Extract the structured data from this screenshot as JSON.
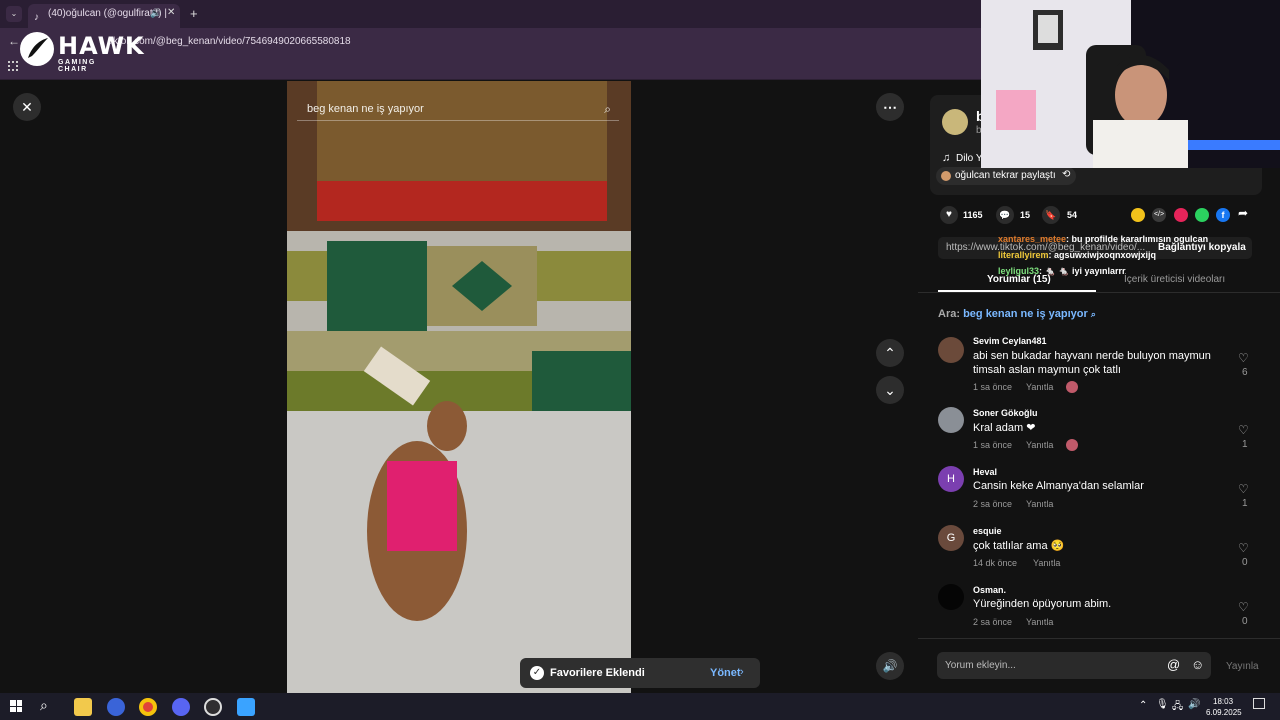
{
  "browser": {
    "tab_title": "(40)oğulcan (@ogulfirattt) |",
    "url": "tiktok.com/@beg_kenan/video/7546949020665580818"
  },
  "overlay": {
    "brand": "HAWK",
    "brand_sub": "GAMING CHAIR"
  },
  "video": {
    "search_text": "beg kenan ne iş yapıyor"
  },
  "toast": {
    "message": "Favorilere Eklendi",
    "action": "Yönet"
  },
  "panel": {
    "author_initial": "b",
    "author_sub": "b",
    "music": "Dilo Y",
    "repost": "oğulcan tekrar paylaştı",
    "likes": "1165",
    "comments_count": "15",
    "saves": "54",
    "link_url": "https://www.tiktok.com/@beg_kenan/video/...",
    "copy_link": "Bağlantıyı kopyala",
    "tabs": [
      "Yorumlar (15)",
      "İçerik üreticisi videoları"
    ],
    "search_label": "Ara:",
    "search_query": "beg kenan ne iş yapıyor",
    "comments": [
      {
        "user": "Sevim Ceylan481",
        "text": "abi sen bukadar hayvanı nerde buluyon maymun timsah aslan maymun çok tatlı",
        "time": "1 sa önce",
        "reply": "Yanıtla",
        "likes": "6",
        "avatar": "",
        "avatar_color": "#6b4a3a"
      },
      {
        "user": "Soner Gökoğlu",
        "text": "Kral adam ❤",
        "time": "1 sa önce",
        "reply": "Yanıtla",
        "likes": "1",
        "avatar": "",
        "avatar_color": "#8a8f96"
      },
      {
        "user": "Heval",
        "text": "Cansin keke Almanya'dan selamlar",
        "time": "2 sa önce",
        "reply": "Yanıtla",
        "likes": "1",
        "avatar": "H",
        "avatar_color": "#7b3fb0"
      },
      {
        "user": "esquie",
        "text": "çok tatlılar ama 🥺",
        "time": "14 dk önce",
        "reply": "Yanıtla",
        "likes": "0",
        "avatar": "G",
        "avatar_color": "#6a4a3c"
      },
      {
        "user": "Osman.",
        "text": "Yüreğinden öpüyorum abim.",
        "time": "2 sa önce",
        "reply": "Yanıtla",
        "likes": "0",
        "avatar": "",
        "avatar_color": "#050505"
      }
    ],
    "comment_placeholder": "Yorum ekleyin...",
    "post_label": "Yayınla"
  },
  "chat": [
    {
      "user": "xantares_metee",
      "color": "#e07b2b",
      "text": ": bu profilde kararlımısın ogulcan"
    },
    {
      "user": "literallyirem",
      "color": "#f0c93a",
      "text": ": agsuwxiwjxoqnxowjxijq"
    },
    {
      "user": "leyligul33",
      "color": "#7ee07e",
      "text": ": 🐁 🐁 iyi yayınlarrr"
    }
  ],
  "taskbar": {
    "time": "18:03",
    "date": "6.09.2025"
  }
}
